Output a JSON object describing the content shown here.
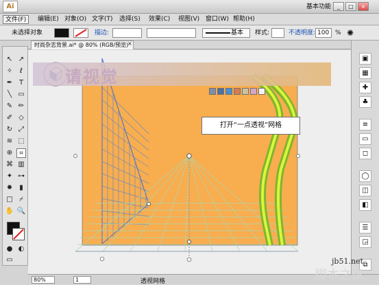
{
  "app": {
    "logo": "Ai",
    "workspace": "基本功能",
    "menu": [
      "文件(F)",
      "编辑(E)",
      "对象(O)",
      "文字(T)",
      "选择(S)",
      "效果(C)",
      "视图(V)",
      "窗口(W)",
      "帮助(H)"
    ],
    "controls": {
      "object_label": "未选择对象",
      "stroke_label": "描边:",
      "basic_label": "基本",
      "style_label": "样式:",
      "opacity_label": "不透明度:",
      "opacity_value": "100",
      "percent": "%"
    },
    "tab_title": "时尚杂志背景.ai* @ 80% (RGB/预览)",
    "status_zoom": "80%",
    "status_page": "1",
    "status_text": "透视网格",
    "callout": "打开“一点透视”网格",
    "overlay": "请视觉",
    "watermark_url": "jb51.net",
    "watermark_name": "脚本之家",
    "window_controls": [
      "_",
      "□",
      "×"
    ],
    "colors": {
      "artboard": "#F8AD4F",
      "grid_blue": "#5C87C8",
      "grid_green": "#A7D8B1",
      "lime": "#B8E81F"
    },
    "icons": {
      "perspective_widget": "cube-icon",
      "tools": [
        "selection-icon",
        "direct-select-icon",
        "magic-wand-icon",
        "lasso-icon",
        "pen-icon",
        "type-icon",
        "line-icon",
        "rect-icon",
        "brush-icon",
        "pencil-icon",
        "blob-brush-icon",
        "eraser-icon",
        "rotate-icon",
        "scale-icon",
        "warp-icon",
        "free-transform-icon",
        "shape-builder-icon",
        "perspective-grid-icon",
        "mesh-icon",
        "gradient-icon",
        "eyedropper-icon",
        "blend-icon",
        "symbol-sprayer-icon",
        "graph-icon",
        "artboard-icon",
        "slice-icon",
        "hand-icon",
        "zoom-icon"
      ]
    }
  }
}
